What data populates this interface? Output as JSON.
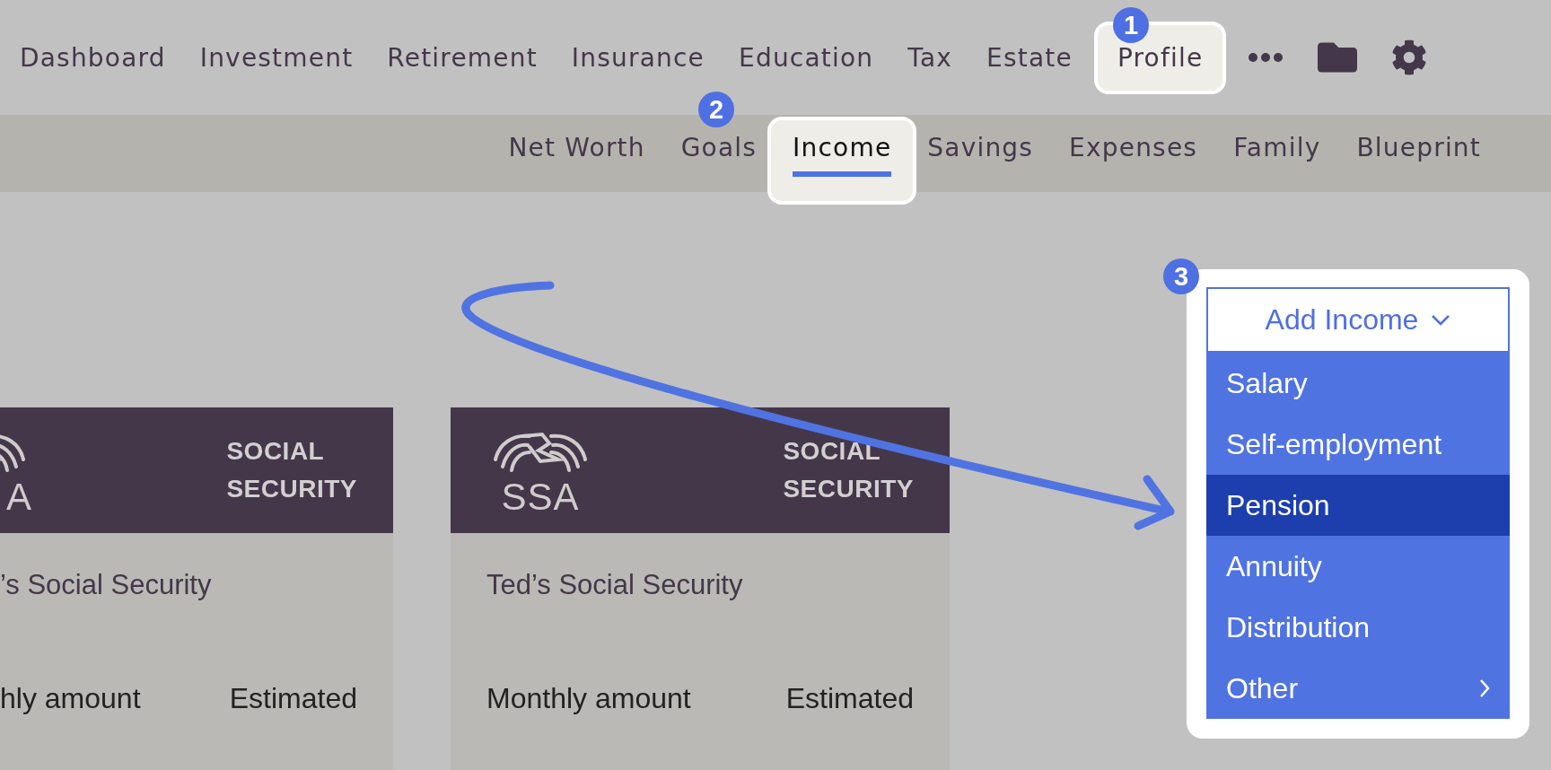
{
  "top_nav": {
    "items": [
      {
        "label": "Dashboard",
        "selected": false
      },
      {
        "label": "Investment",
        "selected": false
      },
      {
        "label": "Retirement",
        "selected": false
      },
      {
        "label": "Insurance",
        "selected": false
      },
      {
        "label": "Education",
        "selected": false
      },
      {
        "label": "Tax",
        "selected": false
      },
      {
        "label": "Estate",
        "selected": false
      },
      {
        "label": "Profile",
        "selected": true
      }
    ]
  },
  "sub_nav": {
    "items": [
      {
        "label": "Net Worth",
        "selected": false
      },
      {
        "label": "Goals",
        "selected": false
      },
      {
        "label": "Income",
        "selected": true
      },
      {
        "label": "Savings",
        "selected": false
      },
      {
        "label": "Expenses",
        "selected": false
      },
      {
        "label": "Family",
        "selected": false
      },
      {
        "label": "Blueprint",
        "selected": false
      }
    ]
  },
  "cards": [
    {
      "cropped": true,
      "logo_text": "A",
      "heading": "SOCIAL\nSECURITY",
      "title": "’s Social Security",
      "amount_label": "hly amount",
      "amount_value": "Estimated"
    },
    {
      "cropped": false,
      "logo_text": "SSA",
      "heading": "SOCIAL\nSECURITY",
      "title": "Ted’s Social Security",
      "amount_label": "Monthly amount",
      "amount_value": "Estimated"
    }
  ],
  "add_income": {
    "label": "Add Income",
    "expanded": true,
    "options": [
      {
        "label": "Salary",
        "selected": false,
        "submenu": false
      },
      {
        "label": "Self-employment",
        "selected": false,
        "submenu": false
      },
      {
        "label": "Pension",
        "selected": true,
        "submenu": false
      },
      {
        "label": "Annuity",
        "selected": false,
        "submenu": false
      },
      {
        "label": "Distribution",
        "selected": false,
        "submenu": false
      },
      {
        "label": "Other",
        "selected": false,
        "submenu": true
      }
    ]
  },
  "callouts": [
    {
      "number": "1"
    },
    {
      "number": "2"
    },
    {
      "number": "3"
    }
  ]
}
